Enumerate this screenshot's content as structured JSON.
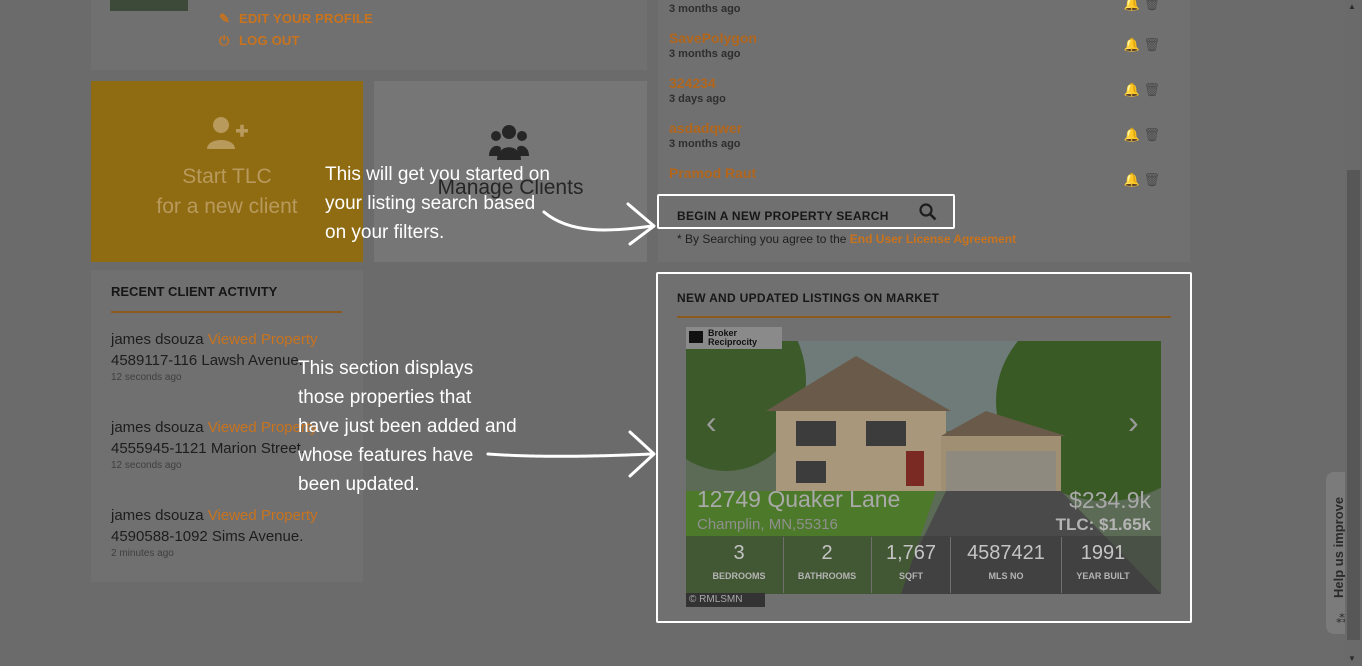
{
  "profile": {
    "edit_label": "EDIT YOUR PROFILE",
    "logout_label": "LOG OUT"
  },
  "tiles": {
    "tlc_line1": "Start TLC",
    "tlc_line2": "for a new client",
    "clients_label": "Manage Clients"
  },
  "recent_activity": {
    "title": "RECENT CLIENT ACTIVITY",
    "items": [
      {
        "user": "james dsouza",
        "action": "Viewed Property",
        "detail": "4589117-116 Lawsh Avenue.",
        "time": "12 seconds ago"
      },
      {
        "user": "james dsouza",
        "action": "Viewed Property",
        "detail": "4555945-1121 Marion Street.",
        "time": "12 seconds ago"
      },
      {
        "user": "james dsouza",
        "action": "Viewed Property",
        "detail": "4590588-1092 Sims Avenue.",
        "time": "2 minutes ago"
      }
    ]
  },
  "saved_searches": [
    {
      "name": "",
      "date": "3 months ago"
    },
    {
      "name": "SavePolygon",
      "date": "3 months ago"
    },
    {
      "name": "324234",
      "date": "3 days ago"
    },
    {
      "name": "asdadqwer",
      "date": "3 months ago"
    },
    {
      "name": "Pramod Raut",
      "date": ""
    }
  ],
  "search": {
    "begin_label": "BEGIN A NEW PROPERTY SEARCH",
    "eula_prefix": "* By Searching you agree to the",
    "eula_link": "End User License Agreement"
  },
  "listings": {
    "title": "NEW AND UPDATED LISTINGS ON MARKET",
    "broker_line1": "Broker",
    "broker_line2": "Reciprocity",
    "watermark": "© RMLSMN",
    "address": "12749 Quaker Lane",
    "city": "Champlin, MN,55316",
    "price": "$234.9k",
    "tlc": "TLC: $1.65k",
    "stats": [
      {
        "value": "3",
        "label": "BEDROOMS"
      },
      {
        "value": "2",
        "label": "BATHROOMS"
      },
      {
        "value": "1,767",
        "label": "SQFT"
      },
      {
        "value": "4587421",
        "label": "MLS NO"
      },
      {
        "value": "1991",
        "label": "YEAR BUILT"
      }
    ]
  },
  "annotations": {
    "search_note": [
      "This will get you started on",
      "your listing search based",
      "on your filters."
    ],
    "listing_note": [
      "This section displays",
      "those properties that",
      "have just been added and",
      "whose features have",
      "been updated."
    ]
  },
  "help_tab": {
    "label": "Help us improve"
  }
}
